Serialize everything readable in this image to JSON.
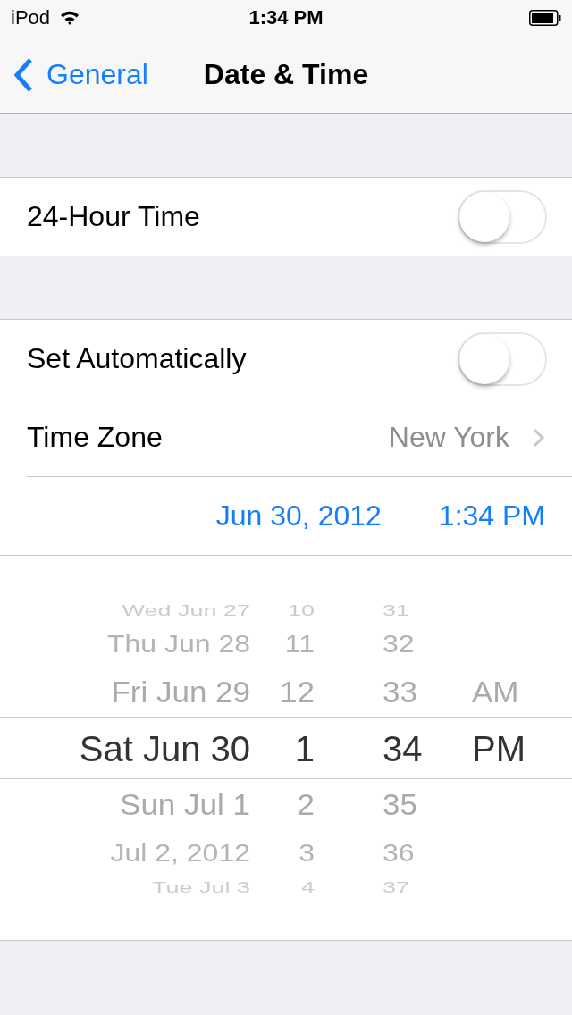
{
  "status_bar": {
    "carrier": "iPod",
    "time": "1:34 PM"
  },
  "nav_bar": {
    "back": "General",
    "title": "Date & Time"
  },
  "groups": [
    {
      "rows": [
        {
          "kind": "toggle",
          "label": "24-Hour Time",
          "on": false
        }
      ]
    },
    {
      "rows": [
        {
          "kind": "toggle",
          "label": "Set Automatically",
          "on": false
        },
        {
          "kind": "detail",
          "label": "Time Zone",
          "value": "New York"
        },
        {
          "kind": "datetime",
          "date": "Jun 30, 2012",
          "time": "1:34 PM"
        }
      ]
    }
  ],
  "picker": {
    "rows": [
      {
        "date": "Wed Jun 27",
        "hour": "10",
        "minute": "31",
        "selected": false
      },
      {
        "date": "Thu Jun 28",
        "hour": "11",
        "minute": "32",
        "selected": false
      },
      {
        "date": "Fri Jun 29",
        "hour": "12",
        "minute": "33",
        "period": "AM",
        "selected": false
      },
      {
        "date": "Sat Jun 30",
        "hour": "1",
        "minute": "34",
        "period": "PM",
        "selected": true
      },
      {
        "date": "Sun Jul 1",
        "hour": "2",
        "minute": "35",
        "selected": false
      },
      {
        "date": "Jul 2, 2012",
        "hour": "3",
        "minute": "36",
        "selected": false
      },
      {
        "date": "Tue Jul 3",
        "hour": "4",
        "minute": "37",
        "selected": false
      }
    ]
  }
}
